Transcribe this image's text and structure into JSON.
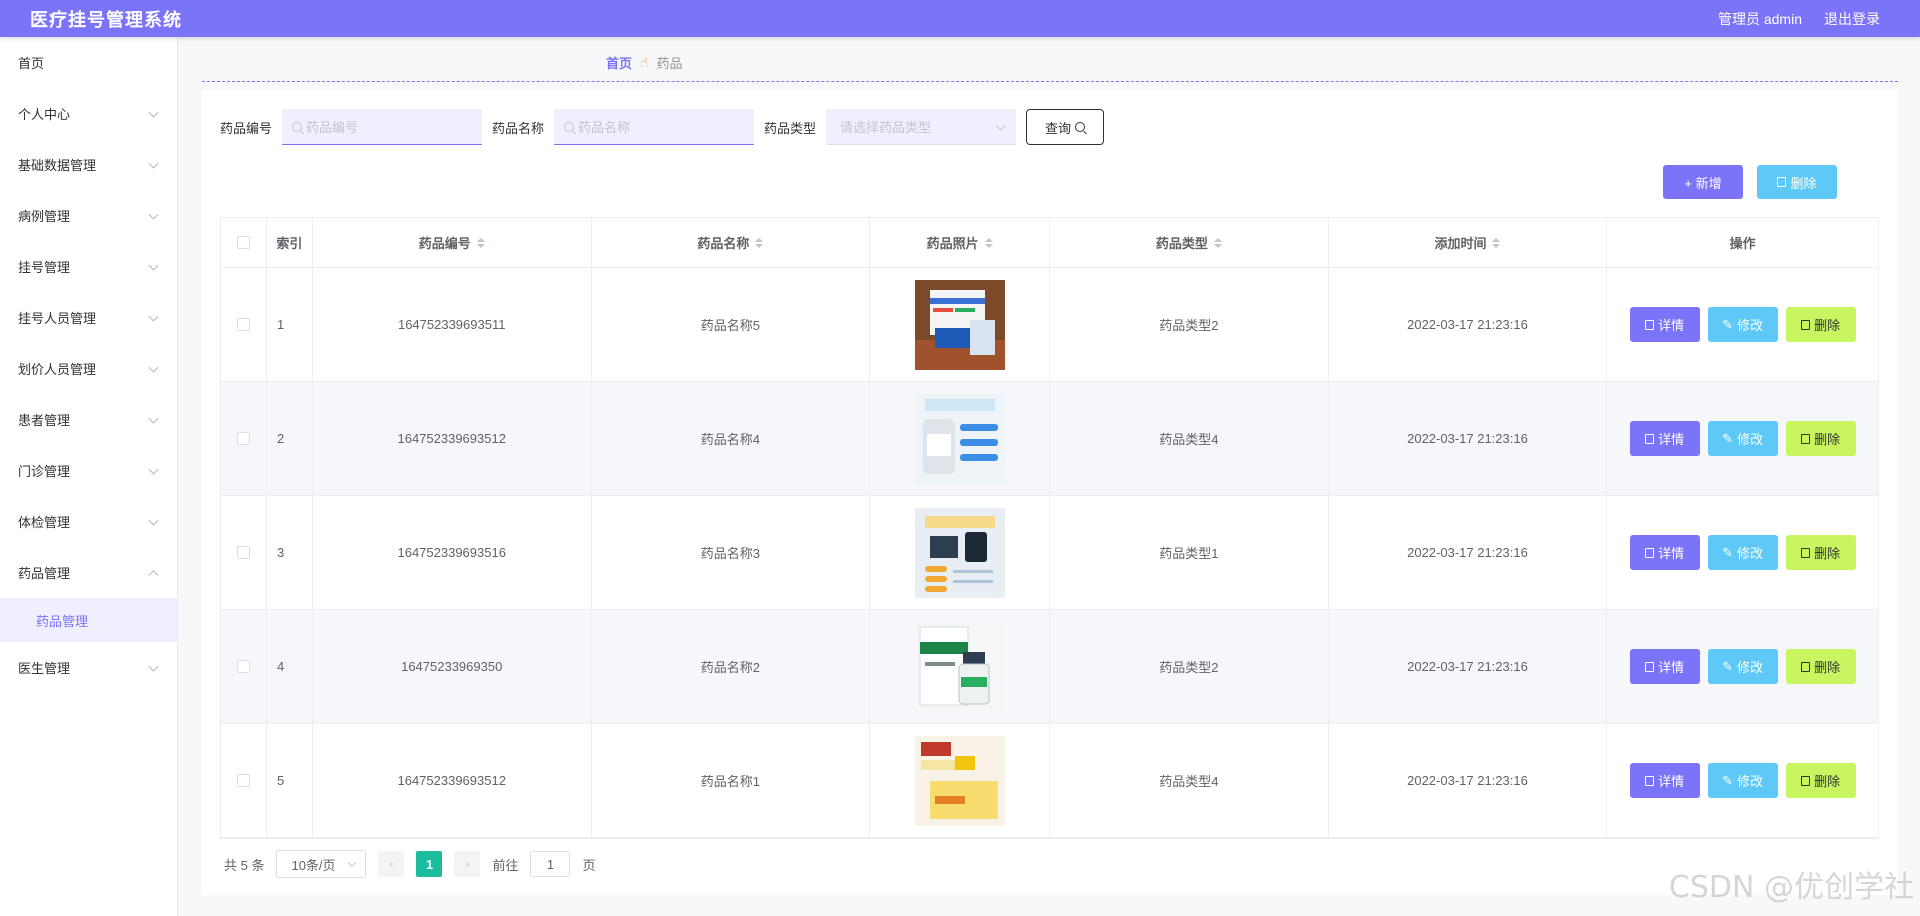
{
  "header": {
    "title": "医疗挂号管理系统",
    "user": "管理员 admin",
    "logout": "退出登录"
  },
  "sidebar": {
    "items": [
      {
        "label": "首页"
      },
      {
        "label": "个人中心"
      },
      {
        "label": "基础数据管理"
      },
      {
        "label": "病例管理"
      },
      {
        "label": "挂号管理"
      },
      {
        "label": "挂号人员管理"
      },
      {
        "label": "划价人员管理"
      },
      {
        "label": "患者管理"
      },
      {
        "label": "门诊管理"
      },
      {
        "label": "体检管理"
      },
      {
        "label": "药品管理"
      },
      {
        "label": "医生管理"
      }
    ],
    "sub_item": "药品管理"
  },
  "breadcrumb": {
    "home": "首页",
    "current": "药品"
  },
  "search": {
    "code_label": "药品编号",
    "code_placeholder": "药品编号",
    "name_label": "药品名称",
    "name_placeholder": "药品名称",
    "type_label": "药品类型",
    "type_placeholder": "请选择药品类型",
    "query_label": "查询"
  },
  "toolbar": {
    "add_label": "+ 新增",
    "delete_label": "删除"
  },
  "table": {
    "headers": [
      "索引",
      "药品编号",
      "药品名称",
      "药品照片",
      "药品类型",
      "添加时间",
      "操作"
    ],
    "rows": [
      {
        "index": "1",
        "code": "164752339693511",
        "name": "药品名称5",
        "type": "药品类型2",
        "time": "2022-03-17 21:23:16"
      },
      {
        "index": "2",
        "code": "164752339693512",
        "name": "药品名称4",
        "type": "药品类型4",
        "time": "2022-03-17 21:23:16"
      },
      {
        "index": "3",
        "code": "164752339693516",
        "name": "药品名称3",
        "type": "药品类型1",
        "time": "2022-03-17 21:23:16"
      },
      {
        "index": "4",
        "code": "16475233969350",
        "name": "药品名称2",
        "type": "药品类型2",
        "time": "2022-03-17 21:23:16"
      },
      {
        "index": "5",
        "code": "164752339693512",
        "name": "药品名称1",
        "type": "药品类型4",
        "time": "2022-03-17 21:23:16"
      }
    ],
    "op_detail": "详情",
    "op_edit": "修改",
    "op_delete": "删除"
  },
  "pagination": {
    "total": "共 5 条",
    "page_size": "10条/页",
    "current": "1",
    "goto_prefix": "前往",
    "goto_value": "1",
    "goto_suffix": "页"
  },
  "watermark": "CSDN @优创学社",
  "colors": {
    "accent": "#7b73f8",
    "info": "#5ec8f7",
    "lime": "#c8f560",
    "page_active": "#1abc9c"
  }
}
